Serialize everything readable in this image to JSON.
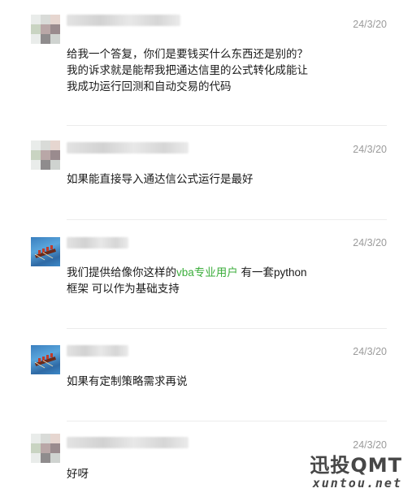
{
  "comments": [
    {
      "avatar": "mosaic-avatar-icon",
      "time": "24/3/20",
      "lines": [
        "给我一个答复，你们是要钱买什么东西还是别的？",
        "我的诉求就是能帮我把通达信里的公式转化成能让",
        "我成功运行回测和自动交易的代码"
      ]
    },
    {
      "avatar": "mosaic-avatar-icon",
      "time": "24/3/20",
      "lines": [
        "如果能直接导入通达信公式运行是最好"
      ]
    },
    {
      "avatar": "rowing-boat-avatar-icon",
      "time": "24/3/20",
      "line1_before": "我们提供给像你这样的",
      "line1_link": "vba专业用户",
      "line1_after": " 有一套python",
      "line2": "框架 可以作为基础支持"
    },
    {
      "avatar": "rowing-boat-avatar-icon",
      "time": "24/3/20",
      "lines": [
        "如果有定制策略需求再说"
      ]
    },
    {
      "avatar": "mosaic-avatar-icon",
      "time": "24/3/20",
      "lines": [
        "好呀"
      ]
    }
  ],
  "colors": {
    "link": "#3cae3c",
    "time": "#9b9b9b",
    "watermark": "#474747"
  },
  "watermark": {
    "title": "迅投QMT",
    "url": "xuntou.net"
  }
}
